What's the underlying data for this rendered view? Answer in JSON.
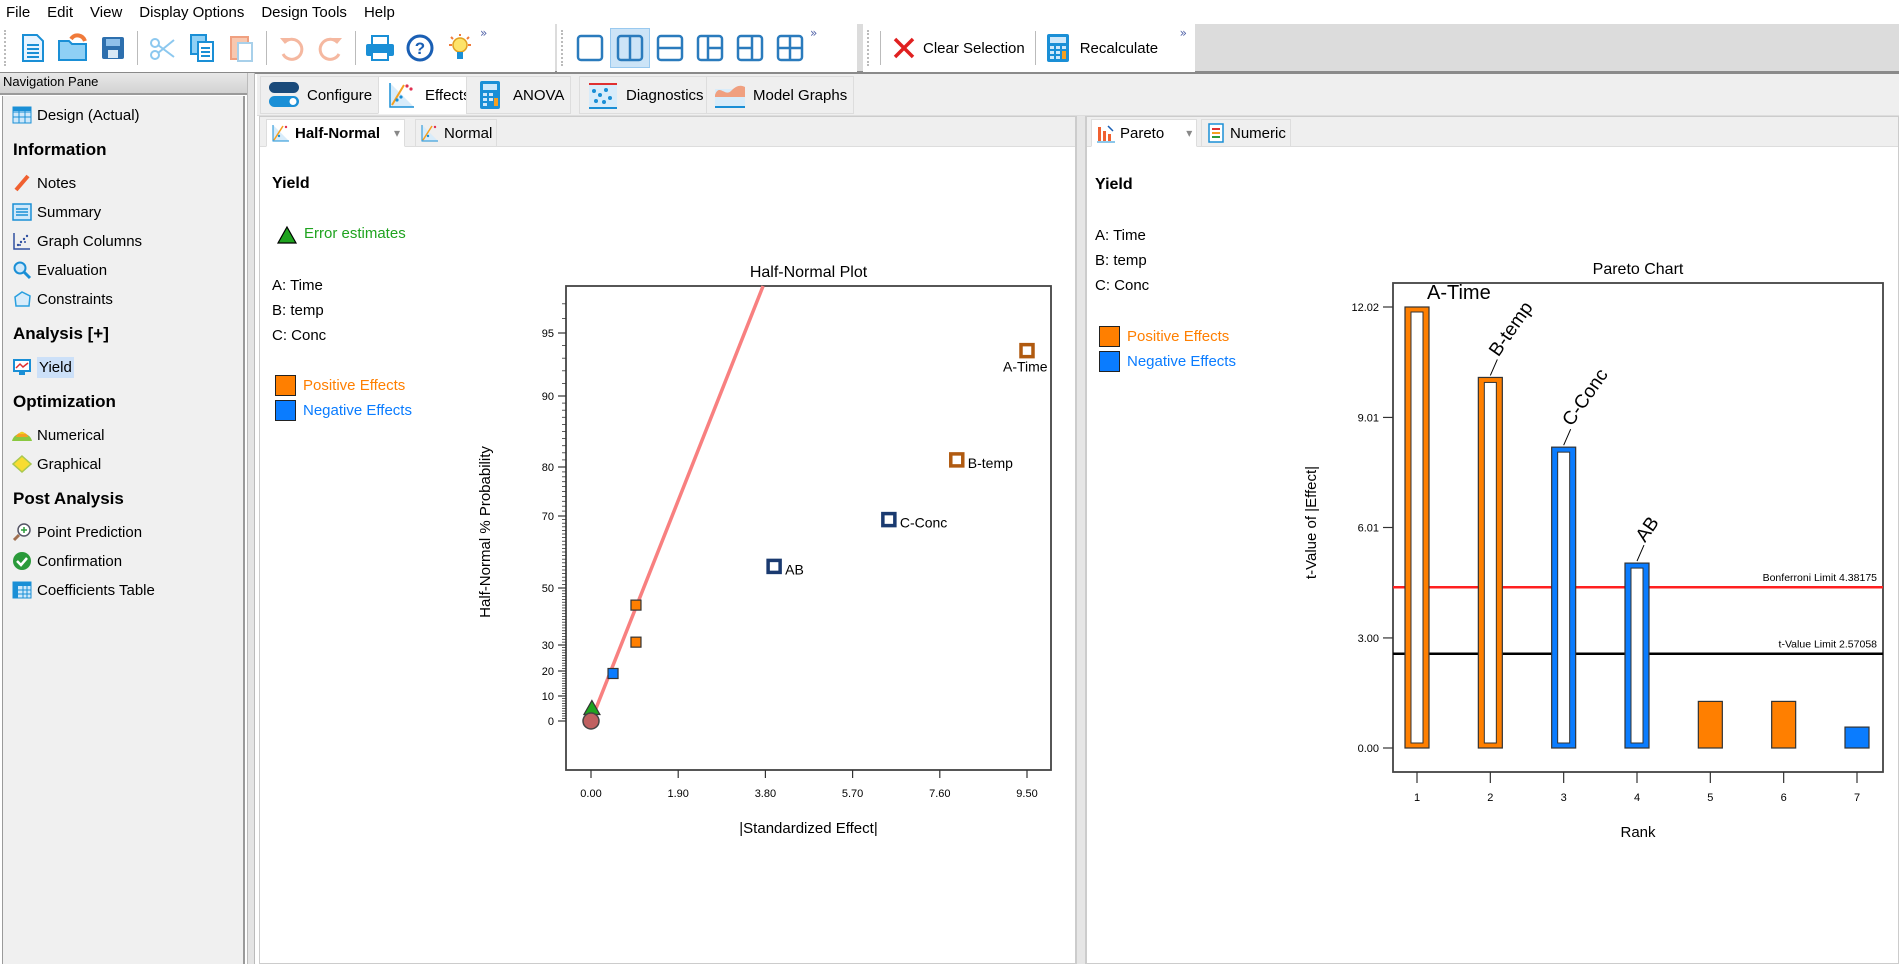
{
  "menu": [
    "File",
    "Edit",
    "View",
    "Display Options",
    "Design Tools",
    "Help"
  ],
  "toolbar": {
    "buttons": [
      "new-file",
      "open-file",
      "save",
      "cut",
      "copy",
      "paste",
      "undo",
      "redo",
      "print",
      "help",
      "tips",
      "more"
    ],
    "layout_buttons": [
      "single-pane",
      "two-pane-vertical",
      "two-pane-horizontal",
      "three-pane-right",
      "three-pane-left",
      "four-pane"
    ],
    "clear_selection": "Clear Selection",
    "recalculate": "Recalculate"
  },
  "nav": {
    "header": "Navigation Pane",
    "design": "Design (Actual)",
    "sections": [
      {
        "title": "Information",
        "items": [
          "Notes",
          "Summary",
          "Graph Columns",
          "Evaluation",
          "Constraints"
        ]
      },
      {
        "title": "Analysis [+]",
        "items": [
          "Yield"
        ]
      },
      {
        "title": "Optimization",
        "items": [
          "Numerical",
          "Graphical"
        ]
      },
      {
        "title": "Post Analysis",
        "items": [
          "Point Prediction",
          "Confirmation",
          "Coefficients Table"
        ]
      }
    ],
    "selected": "Yield"
  },
  "main_tabs": [
    "Configure",
    "Effects",
    "ANOVA",
    "Diagnostics",
    "Model Graphs"
  ],
  "active_main_tab": "Effects",
  "left_pane": {
    "tabs": [
      "Half-Normal",
      "Normal"
    ],
    "response": "Yield",
    "error_label": "Error estimates",
    "factors": [
      "A: Time",
      "B: temp",
      "C: Conc"
    ],
    "positive": "Positive Effects",
    "negative": "Negative Effects"
  },
  "right_pane": {
    "tabs": [
      "Pareto",
      "Numeric"
    ],
    "response": "Yield",
    "factors": [
      "A: Time",
      "B: temp",
      "C: Conc"
    ],
    "positive": "Positive Effects",
    "negative": "Negative Effects"
  },
  "colors": {
    "positive": "#ff7f00",
    "negative": "#0a7cff",
    "error": "#1fa31f",
    "fit_line": "#f88080",
    "bonferroni": "#ff2020",
    "tlimit": "#000000"
  },
  "chart_data": [
    {
      "type": "scatter",
      "title": "Half-Normal Plot",
      "xlabel": "|Standardized Effect|",
      "ylabel": "Half-Normal % Probability",
      "xticks": [
        "0.00",
        "1.90",
        "3.80",
        "5.70",
        "7.60",
        "9.50"
      ],
      "xlim": [
        0,
        9.5
      ],
      "yticks": [
        0,
        10,
        20,
        30,
        50,
        70,
        80,
        90,
        95
      ],
      "points": [
        {
          "x": 9.5,
          "y": 93.6,
          "sign": "positive",
          "label": "A-Time",
          "significant": true
        },
        {
          "x": 7.97,
          "y": 81,
          "sign": "positive",
          "label": "B-temp",
          "significant": true
        },
        {
          "x": 6.49,
          "y": 69,
          "sign": "negative",
          "label": "C-Conc",
          "significant": true
        },
        {
          "x": 3.99,
          "y": 56,
          "sign": "negative",
          "label": "AB",
          "significant": true
        },
        {
          "x": 0.98,
          "y": 44,
          "sign": "positive",
          "label": "",
          "significant": false
        },
        {
          "x": 0.98,
          "y": 31,
          "sign": "positive",
          "label": "",
          "significant": false
        },
        {
          "x": 0.48,
          "y": 19,
          "sign": "negative",
          "label": "",
          "significant": false
        },
        {
          "x": 0.02,
          "y": 5,
          "sign": "error",
          "label": "",
          "significant": false
        },
        {
          "x": 0.0,
          "y": 0,
          "sign": "origin",
          "label": "",
          "significant": false
        }
      ],
      "fit_line": {
        "from": [
          0,
          0
        ],
        "to": [
          3.75,
          100
        ]
      }
    },
    {
      "type": "bar",
      "title": "Pareto Chart",
      "xlabel": "Rank",
      "ylabel": "t-Value of |Effect|",
      "categories": [
        "1",
        "2",
        "3",
        "4",
        "5",
        "6",
        "7"
      ],
      "yticks": [
        "0.00",
        "3.00",
        "6.01",
        "9.01",
        "12.02"
      ],
      "values": [
        12.02,
        10.1,
        8.2,
        5.04,
        1.27,
        1.27,
        0.57
      ],
      "signs": [
        "positive",
        "positive",
        "negative",
        "negative",
        "positive",
        "positive",
        "negative"
      ],
      "labels": [
        "A-Time",
        "B-temp",
        "C-Conc",
        "AB",
        "",
        "",
        ""
      ],
      "significant": [
        true,
        true,
        true,
        true,
        false,
        false,
        false
      ],
      "bonferroni_limit": 4.38175,
      "bonferroni_label": "Bonferroni Limit 4.38175",
      "t_limit": 2.57058,
      "t_limit_label": "t-Value Limit 2.57058"
    }
  ]
}
